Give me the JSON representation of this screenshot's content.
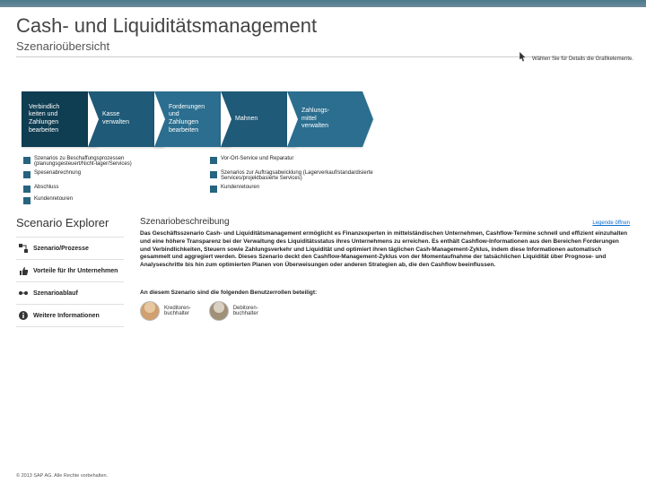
{
  "header": {
    "title": "Cash- und Liquiditätsmanagement",
    "subtitle": "Szenarioübersicht"
  },
  "hint": "Wählen Sie für Details die Grafikelemente.",
  "chevrons": [
    "Verbindlich\nkeiten und\nZahlungen\nbearbeiten",
    "Kasse\nverwalten",
    "Forderungen\nund\nZahlungen\nbearbeiten",
    "Mahnen",
    "Zahlungs-\nmittel\nverwalten"
  ],
  "legend": {
    "row1": [
      "Szenarios zu Beschaffungsprozessen (planungsgesteuert/Nicht-lager/Services)",
      "Vor-Ort-Service und Reparatur"
    ],
    "row2": [
      "Spesenabrechnung",
      "Szenarios zur Auftragsabwicklung (Lagerverkauf/standardisierte Services/projektbasierte Services)"
    ],
    "row3": [
      "Abschluss",
      "Kundenretouren"
    ],
    "row4": [
      "Kundenretouren"
    ]
  },
  "explorer": {
    "title": "Scenario Explorer",
    "nav": [
      "Szenario/Prozesse",
      "Vorteile für Ihr Unternehmen",
      "Szenarioablauf",
      "Weitere Informationen"
    ]
  },
  "description": {
    "heading": "Szenariobeschreibung",
    "link": "Legende öffnen",
    "body": "Das Geschäftsszenario Cash- und Liquiditätsmanagement ermöglicht es Finanzexperten in mittelständischen Unternehmen, Cashflow-Termine schnell und effizient einzuhalten und eine höhere Transparenz bei der Verwaltung des Liquiditätsstatus ihres Unternehmens zu erreichen. Es enthält Cashflow-Informationen aus den Bereichen Forderungen und Verbindlichkeiten, Steuern sowie Zahlungsverkehr und Liquidität und optimiert ihren täglichen Cash-Management-Zyklus, indem diese Informationen automatisch gesammelt und aggregiert werden. Dieses Szenario deckt den Cashflow-Management-Zyklus von der Momentaufnahme der tatsächlichen Liquidität über Prognose- und Analyseschritte bis hin zum optimierten Planen von Überweisungen oder anderen Strategien ab, die den Cashflow beeinflussen.",
    "roles_label": "An diesem Szenario sind die folgenden Benutzerrollen beteiligt:",
    "roles": [
      "Kreditoren-\nbuchhalter",
      "Debitoren-\nbuchhalter"
    ]
  },
  "footer": "© 2013 SAP AG. Alle Rechte vorbehalten."
}
